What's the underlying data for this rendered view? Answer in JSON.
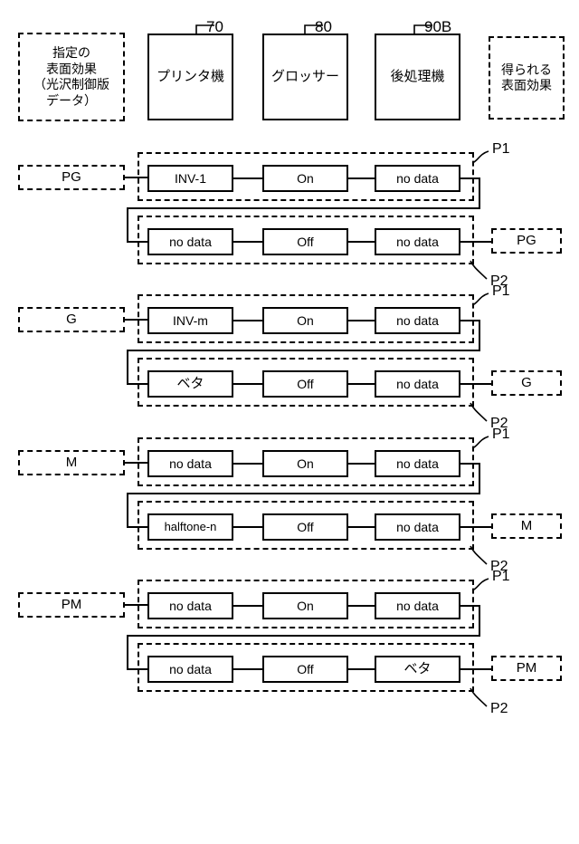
{
  "figure": {
    "header": {
      "input_label": "指定の\n表面効果\n（光沢制御版\nデータ）",
      "input_label_lines": [
        "指定の",
        "表面効果",
        "（光沢制御版",
        "データ）"
      ],
      "output_label_lines": [
        "得られる",
        "表面効果"
      ],
      "units": [
        {
          "name": "プリンタ機",
          "ref": "70"
        },
        {
          "name": "グロッサー",
          "ref": "80"
        },
        {
          "name": "後処理機",
          "ref": "90B"
        }
      ]
    },
    "pass_labels": {
      "first": "P1",
      "second": "P2"
    },
    "rows": [
      {
        "input": "PG",
        "output": "PG",
        "pass1": [
          "INV-1",
          "On",
          "no data"
        ],
        "pass2": [
          "no data",
          "Off",
          "no data"
        ]
      },
      {
        "input": "G",
        "output": "G",
        "pass1": [
          "INV-m",
          "On",
          "no data"
        ],
        "pass2": [
          "ベタ",
          "Off",
          "no data"
        ]
      },
      {
        "input": "M",
        "output": "M",
        "pass1": [
          "no data",
          "On",
          "no data"
        ],
        "pass2": [
          "halftone-n",
          "Off",
          "no data"
        ]
      },
      {
        "input": "PM",
        "output": "PM",
        "pass1": [
          "no data",
          "On",
          "no data"
        ],
        "pass2": [
          "no data",
          "Off",
          "ベタ"
        ]
      }
    ]
  }
}
